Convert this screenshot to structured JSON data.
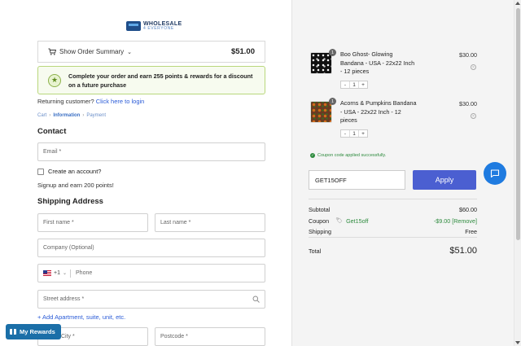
{
  "logo": {
    "main": "WHOLESALE",
    "sub": "4 EVERYONE"
  },
  "order_summary": {
    "label": "Show Order Summary",
    "total": "$51.00"
  },
  "rewards_banner": {
    "text": "Complete your order and earn 255 points & rewards for a discount on a future purchase"
  },
  "returning": {
    "prefix": "Returning customer?",
    "link": "Click here to login"
  },
  "breadcrumb": {
    "cart": "Cart",
    "information": "Information",
    "payment": "Payment"
  },
  "contact": {
    "title": "Contact",
    "email_placeholder": "Email *",
    "create_account_label": "Create an account?",
    "signup_text": "Signup and earn 200 points!"
  },
  "shipping": {
    "title": "Shipping Address",
    "first_name": "First name *",
    "last_name": "Last name *",
    "company": "Company (Optional)",
    "phone_code": "+1",
    "phone_placeholder": "Phone",
    "street": "Street address *",
    "add_apartment": "+ Add Apartment, suite, unit, etc.",
    "city": "City *",
    "postcode": "Postcode *"
  },
  "my_rewards_label": "My Rewards",
  "cart_items": [
    {
      "name": "Boo Ghost- Glowing Bandana - USA - 22x22 Inch - 12 pieces",
      "price": "$30.00",
      "qty": "1",
      "badge": "1"
    },
    {
      "name": "Acorns & Pumpkins Bandana - USA - 22x22 Inch - 12 pieces",
      "price": "$30.00",
      "qty": "1",
      "badge": "1"
    }
  ],
  "coupon": {
    "success_message": "Coupon code applied successfully.",
    "input_value": "GET15OFF",
    "apply_label": "Apply"
  },
  "summary": {
    "subtotal_label": "Subtotal",
    "subtotal_value": "$60.00",
    "coupon_label": "Coupon",
    "coupon_code": "Get15off",
    "coupon_value": "-$9.00 [Remove]",
    "shipping_label": "Shipping",
    "shipping_value": "Free",
    "total_label": "Total",
    "total_value": "$51.00"
  },
  "colors": {
    "accent": "#4b5fd1",
    "success": "#2e8b3e",
    "link": "#2a5bd7",
    "rewards_button": "#1b6fa8",
    "chat": "#1f7be0"
  },
  "icons": [
    "cart-icon",
    "chevron-down-icon",
    "star-badge-icon",
    "us-flag-icon",
    "search-icon",
    "gift-icon",
    "close-circle-icon",
    "check-circle-icon",
    "tag-icon",
    "chat-icon"
  ]
}
